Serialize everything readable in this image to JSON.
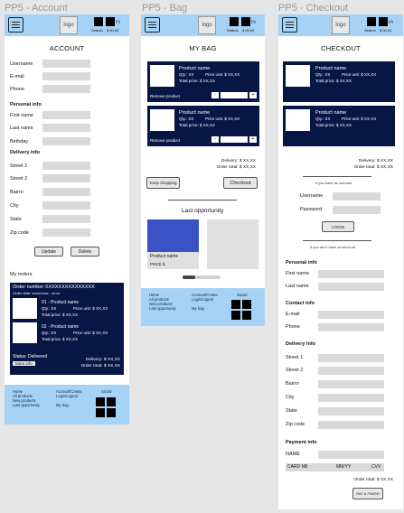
{
  "frames": {
    "account": "PP5 - Account",
    "bag": "PP5 - Bag",
    "checkout": "PP5 - Checkout"
  },
  "header": {
    "logo_text": "logo",
    "cart_count": "(0)",
    "search_label": "Search",
    "cart_total": "$ 00,00"
  },
  "account": {
    "title": "ACCOUNT",
    "fields_top": [
      "Username",
      "E-mail",
      "Phone"
    ],
    "personal_info": "Personal info",
    "personal_fields": [
      "First name",
      "Last name",
      "Birthday"
    ],
    "delivery_info": "Delivery info",
    "delivery_fields": [
      "Street 1",
      "Street 2",
      "Bairro",
      "City",
      "State",
      "Zip code"
    ],
    "update": "Update",
    "delete": "Delete",
    "my_orders": "My orders",
    "order_number": "Order number XXXXXXXXXXXXXXX",
    "order_date": "Order date: xx/xx/xxxx - xx:xx",
    "item1_name": "01 - Product name",
    "item2_name": "02 - Product name",
    "qty": "Qty.: XX",
    "price_unit": "Price unit: $ XX,XX",
    "total_price": "Total price: $ XX,XX",
    "status": "Status: Delivered",
    "delivery": "Delivery: $ XX,XX",
    "order_total": "Order total: $ XX,XX",
    "more_info": "More info"
  },
  "bag": {
    "title": "MY BAG",
    "product_name": "Product name",
    "qty": "Qty.: XX",
    "price_unit": "Price unit: $ XX,XX",
    "total_price": "Total price: $ XX,XX",
    "remove": "Remove product",
    "minus": "-",
    "plus": "+",
    "delivery": "Delivery: $ XX,XX",
    "order_total": "Order total: $ XX,XX",
    "keep_shopping": "Keep shopping",
    "checkout": "Checkout",
    "last_opportunity": "Last opportunity",
    "opp_product": "Product name",
    "opp_price": "PRICE $"
  },
  "checkout": {
    "title": "CHECKOUT",
    "product_name": "Product name",
    "qty": "Qty.: XX",
    "price_unit": "Price unit: $ XX,XX",
    "total_price": "Total price: $ XX,XX",
    "delivery": "Delivery: $ XX,XX",
    "order_total": "Order total: $ XX,XX",
    "have_account": "If you have an account",
    "username": "Username",
    "password": "Password",
    "login": "LOGIN",
    "no_account": "If you don't have an account",
    "personal_info": "Personal info",
    "personal_fields": [
      "First name",
      "Last name"
    ],
    "contact_info": "Contact info",
    "contact_fields": [
      "E-mail",
      "Phone"
    ],
    "delivery_info": "Delivery info",
    "delivery_fields": [
      "Street 1",
      "Street 2",
      "Bairro",
      "City",
      "State",
      "Zip code"
    ],
    "payment_info": "Payment info",
    "name": "NAME",
    "card_nb": "CARD NB",
    "mm_yy": "MM/YY",
    "cvv": "CVV",
    "pay": "PAY & FINISH"
  },
  "footer": {
    "home": "Home",
    "all_products": "All products",
    "new_products": "New products",
    "last_opportunity": "Last opportunity",
    "account_create": "Account/Create",
    "login_logout": "Login/Logout",
    "my_bag": "My bag",
    "social": "Social"
  }
}
